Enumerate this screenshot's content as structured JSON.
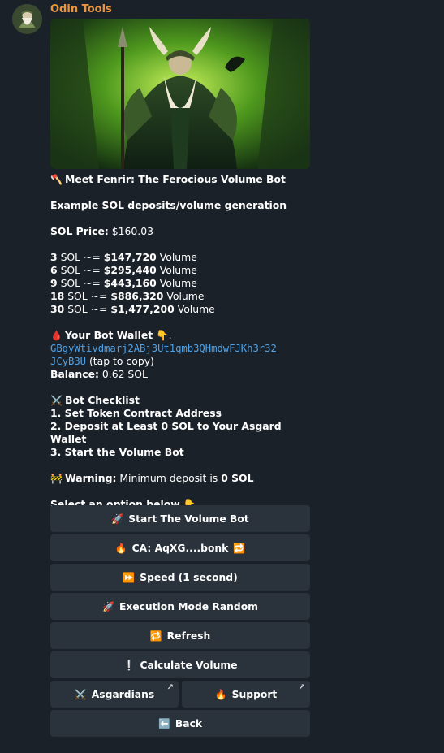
{
  "sender": {
    "name": "Odin Tools"
  },
  "message": {
    "heading_icon": "🪓",
    "heading": "Meet Fenrir: The Ferocious Volume Bot",
    "subheading": "Example SOL deposits/volume generation",
    "price_label": "SOL Price:",
    "price_value": "$160.03",
    "deposits": [
      {
        "sol": "3",
        "mid": " SOL ~= ",
        "vol": "$147,720",
        "tail": " Volume"
      },
      {
        "sol": "6",
        "mid": " SOL ~= ",
        "vol": "$295,440",
        "tail": " Volume"
      },
      {
        "sol": "9",
        "mid": " SOL ~= ",
        "vol": "$443,160",
        "tail": " Volume"
      },
      {
        "sol": "18",
        "mid": " SOL ~= ",
        "vol": "$886,320",
        "tail": " Volume"
      },
      {
        "sol": "30",
        "mid": " SOL ~= ",
        "vol": "$1,477,200",
        "tail": " Volume"
      }
    ],
    "wallet_icon": "🩸",
    "wallet_label": "Your Bot Wallet",
    "wallet_pointer": "👇.",
    "wallet_addr_line1": "GBgyWtivdmarj2ABj3Ut1qmb3QHmdwFJKh3r32",
    "wallet_addr_line2": "JCyB3U",
    "tap_copy": " (tap to copy)",
    "balance_label": "Balance:",
    "balance_value": "0.62 SOL",
    "checklist_icon": "⚔️",
    "checklist_title": "Bot Checklist",
    "checklist": [
      "1. Set Token Contract Address",
      "2. Deposit at Least 0 SOL to Your Asgard Wallet",
      "3. Start the Volume Bot"
    ],
    "warning_icon": "🚧",
    "warning_label": "Warning:",
    "warning_text": " Minimum deposit is ",
    "warning_value": "0 SOL",
    "select_prompt": "Select an option below",
    "select_pointer": "👇"
  },
  "buttons": {
    "start": {
      "icon": "🚀",
      "label": "Start The Volume Bot"
    },
    "ca": {
      "icon": "🔥",
      "label": "CA: AqXG....bonk",
      "trail": "🔁"
    },
    "speed": {
      "icon": "⏩",
      "label": "Speed (1 second)"
    },
    "mode": {
      "icon": "🚀",
      "label": "Execution Mode Random"
    },
    "refresh": {
      "icon": "🔁",
      "label": "Refresh"
    },
    "calc": {
      "icon": "❕",
      "label": "Calculate Volume"
    },
    "asgardians": {
      "icon": "⚔️",
      "label": "Asgardians",
      "link": "↗"
    },
    "support": {
      "icon": "🔥",
      "label": "Support",
      "link": "↗"
    },
    "back": {
      "icon": "⬅️",
      "label": "Back"
    }
  }
}
